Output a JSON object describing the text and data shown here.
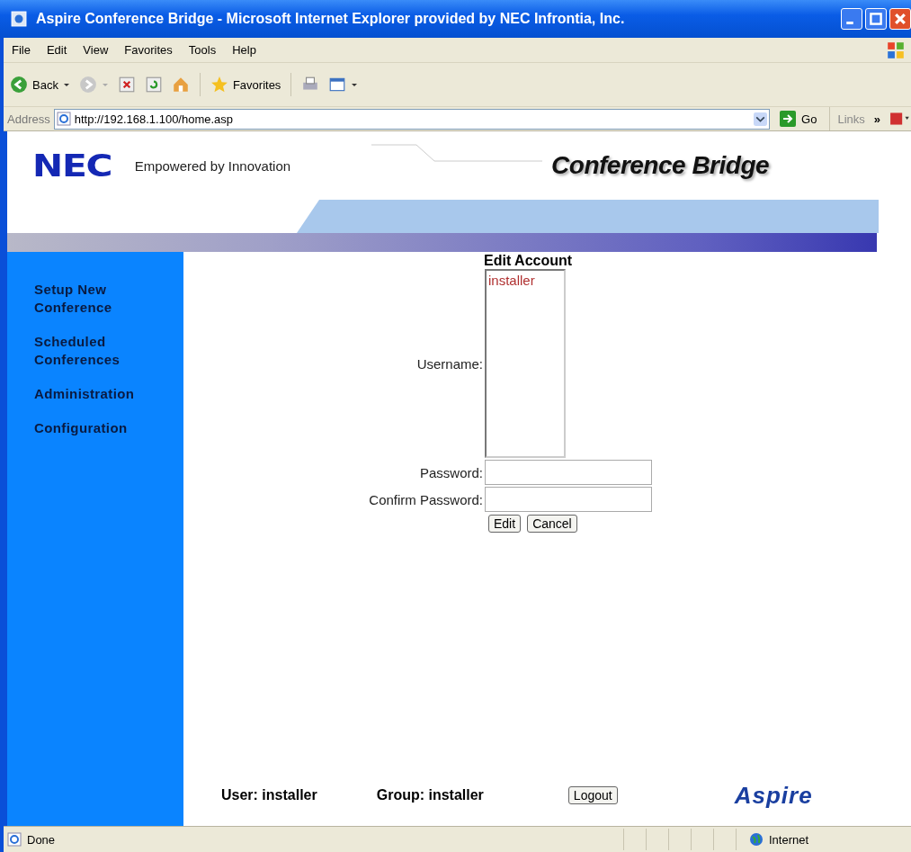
{
  "window": {
    "title": "Aspire Conference Bridge - Microsoft Internet Explorer provided by NEC Infrontia, Inc."
  },
  "menu": [
    "File",
    "Edit",
    "View",
    "Favorites",
    "Tools",
    "Help"
  ],
  "toolbar": {
    "back": "Back",
    "favorites": "Favorites"
  },
  "address_bar": {
    "label": "Address",
    "url": "http://192.168.1.100/home.asp",
    "go": "Go",
    "links": "Links",
    "more": "»"
  },
  "header": {
    "logo": "NEC",
    "tagline": "Empowered by Innovation",
    "product": "Conference Bridge"
  },
  "sidebar": {
    "items": [
      {
        "label": "Setup New Conference"
      },
      {
        "label": "Scheduled Conferences"
      },
      {
        "label": "Administration"
      },
      {
        "label": "Configuration"
      }
    ]
  },
  "form": {
    "title": "Edit Account",
    "username": {
      "label": "Username:",
      "options": [
        "installer"
      ]
    },
    "password": {
      "label": "Password:"
    },
    "confirm": {
      "label": "Confirm Password:"
    },
    "buttons": [
      "Edit",
      "Cancel"
    ]
  },
  "footer": {
    "user": "User: installer",
    "group": "Group: installer",
    "logout": "Logout",
    "brand": "Aspire"
  },
  "status_bar": {
    "text": "Done",
    "zone": "Internet"
  }
}
